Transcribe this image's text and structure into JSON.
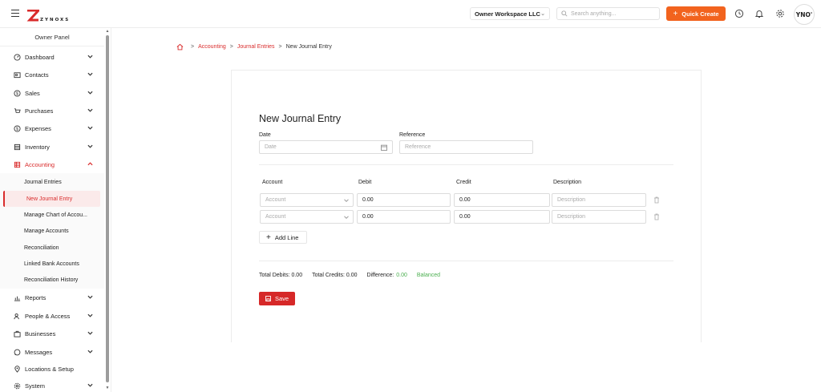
{
  "header": {
    "logo_text": "ZYNOXS",
    "workspace": "Owner Workspace LLC",
    "search_placeholder": "Search anything...",
    "quick_create": "Quick Create",
    "avatar_text": "YNO'"
  },
  "sidebar": {
    "panel_title": "Owner Panel",
    "items": [
      {
        "label": "Dashboard",
        "icon": "dashboard-icon"
      },
      {
        "label": "Contacts",
        "icon": "contacts-icon"
      },
      {
        "label": "Sales",
        "icon": "sales-icon"
      },
      {
        "label": "Purchases",
        "icon": "cart-icon"
      },
      {
        "label": "Expenses",
        "icon": "expenses-icon"
      },
      {
        "label": "Inventory",
        "icon": "inventory-icon"
      },
      {
        "label": "Accounting",
        "icon": "accounting-icon"
      }
    ],
    "accounting_sub": [
      "Journal Entries",
      "New Journal Entry",
      "Manage Chart of Accou...",
      "Manage Accounts",
      "Reconciliation",
      "Linked Bank Accounts",
      "Reconciliation History"
    ],
    "bottom_items": [
      {
        "label": "Reports",
        "icon": "reports-icon"
      },
      {
        "label": "People & Access",
        "icon": "people-icon"
      },
      {
        "label": "Businesses",
        "icon": "business-icon"
      },
      {
        "label": "Messages",
        "icon": "messages-icon"
      },
      {
        "label": "Locations & Setup",
        "icon": "location-icon"
      },
      {
        "label": "System",
        "icon": "system-icon"
      }
    ]
  },
  "breadcrumb": {
    "items": [
      "Accounting",
      "Journal Entries",
      "New Journal Entry"
    ],
    "separator": ">"
  },
  "form": {
    "title": "New Journal Entry",
    "date_label": "Date",
    "date_placeholder": "Date",
    "reference_label": "Reference",
    "reference_placeholder": "Reference",
    "columns": [
      "Account",
      "Debit",
      "Credit",
      "Description"
    ],
    "lines": [
      {
        "account_placeholder": "Account",
        "debit": "0.00",
        "credit": "0.00",
        "description_placeholder": "Description"
      },
      {
        "account_placeholder": "Account",
        "debit": "0.00",
        "credit": "0.00",
        "description_placeholder": "Description"
      }
    ],
    "add_line": "Add Line",
    "totals": {
      "debits": "Total Debits: 0.00",
      "credits": "Total Credits: 0.00",
      "difference_label": "Difference:",
      "difference_value": "0.00",
      "status": "Balanced"
    },
    "save": "Save"
  },
  "colors": {
    "accent": "#d92b2b",
    "quick_create": "#f2631e",
    "balanced": "#4caf50"
  }
}
